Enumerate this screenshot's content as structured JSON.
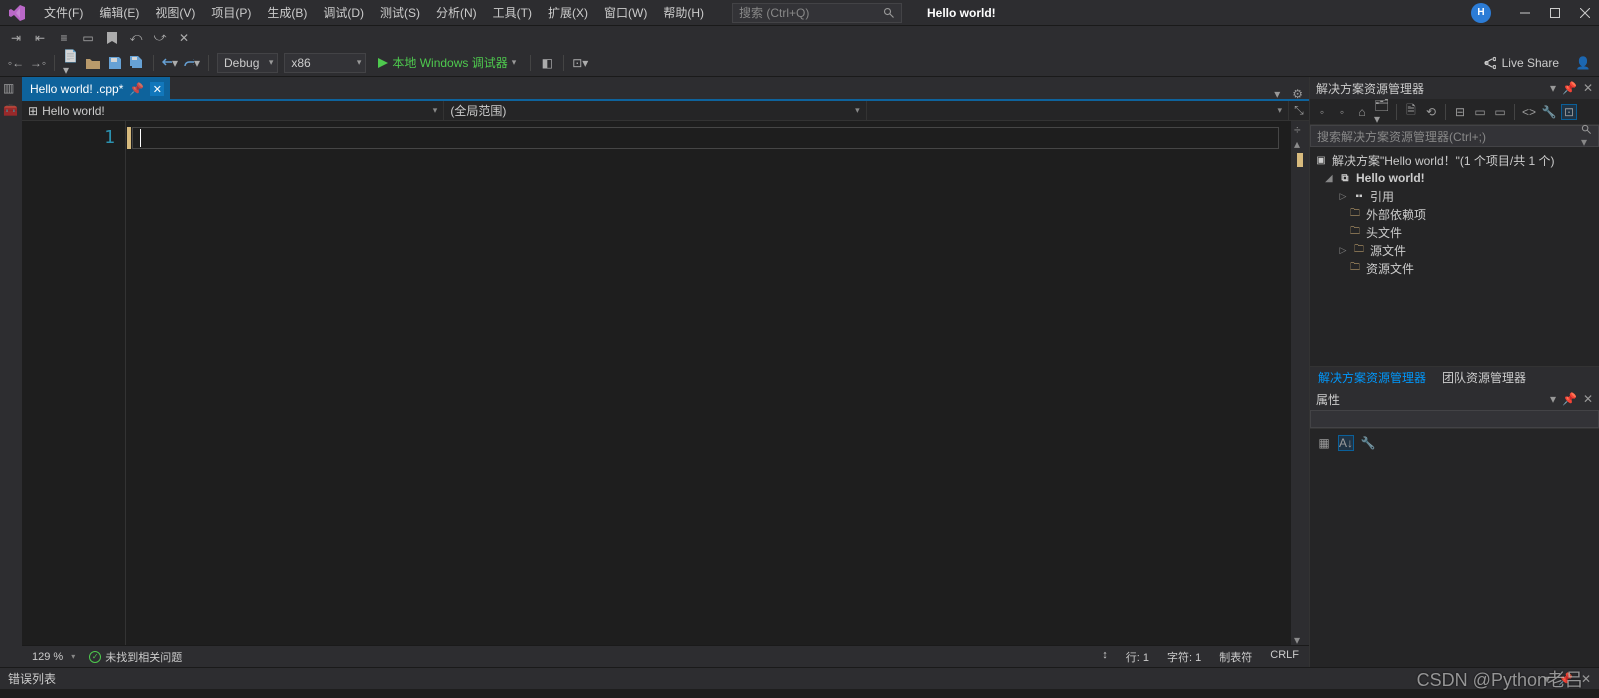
{
  "titlebar": {
    "project": "Hello world!",
    "user_initial": "H"
  },
  "menu": [
    "文件(F)",
    "编辑(E)",
    "视图(V)",
    "项目(P)",
    "生成(B)",
    "调试(D)",
    "测试(S)",
    "分析(N)",
    "工具(T)",
    "扩展(X)",
    "窗口(W)",
    "帮助(H)"
  ],
  "search": {
    "placeholder": "搜索 (Ctrl+Q)"
  },
  "toolbar": {
    "config": "Debug",
    "platform": "x86",
    "debugger": "本地 Windows 调试器",
    "live_share": "Live Share"
  },
  "tabs": [
    {
      "label": "Hello world! .cpp*"
    }
  ],
  "navbar": {
    "project": "Hello world!",
    "scope": "(全局范围)"
  },
  "editor": {
    "line_number": "1"
  },
  "status": {
    "zoom": "129 %",
    "issues": "未找到相关问题",
    "line": "行: 1",
    "char": "字符: 1",
    "tabs": "制表符",
    "eol": "CRLF"
  },
  "solution_explorer": {
    "title": "解决方案资源管理器",
    "search_placeholder": "搜索解决方案资源管理器(Ctrl+;)",
    "root": "解决方案\"Hello world！\"(1 个项目/共 1 个)",
    "project": "Hello world!",
    "nodes": [
      "引用",
      "外部依赖项",
      "头文件",
      "源文件",
      "资源文件"
    ],
    "tabs": [
      "解决方案资源管理器",
      "团队资源管理器"
    ]
  },
  "properties": {
    "title": "属性"
  },
  "error_list": {
    "title": "错误列表"
  },
  "watermark": "CSDN @Python老吕"
}
